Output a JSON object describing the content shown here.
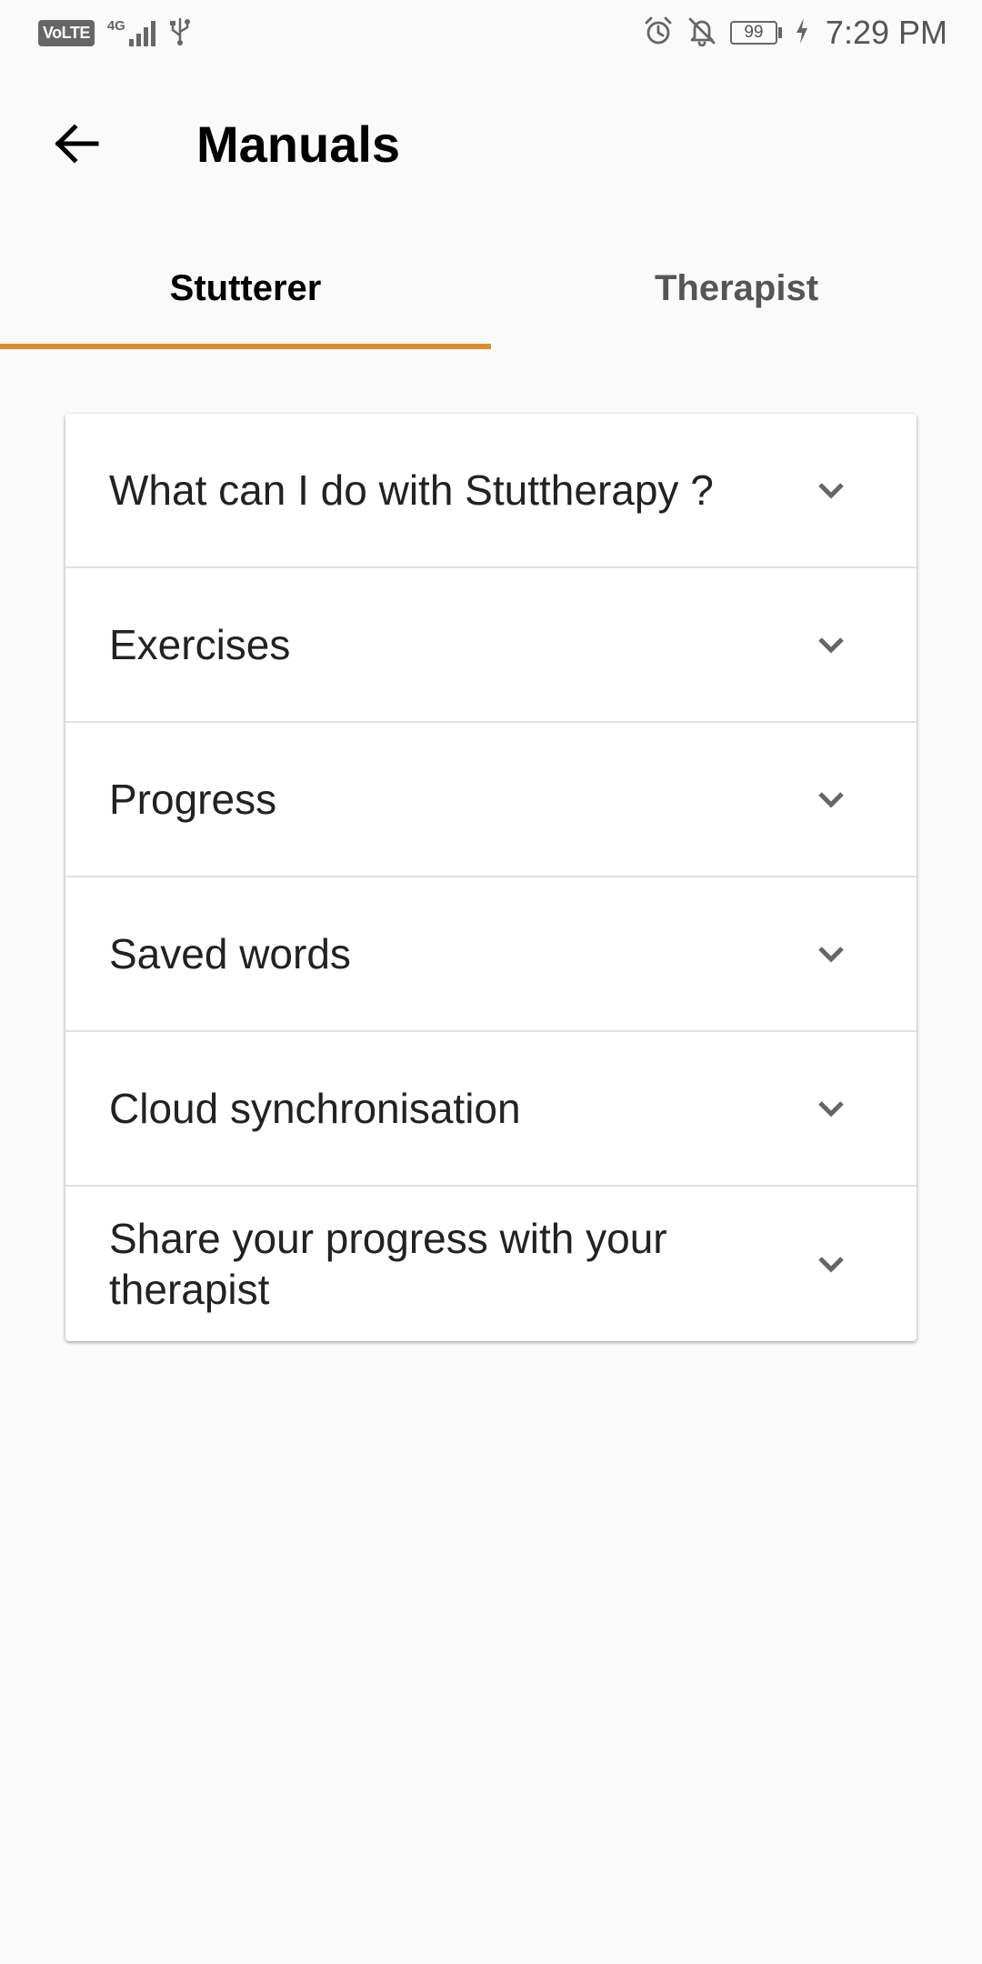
{
  "status_bar": {
    "volte": "VoLTE",
    "network": "4G",
    "battery": "99",
    "time": "7:29 PM"
  },
  "app_bar": {
    "title": "Manuals",
    "back_icon": "arrow-left-icon"
  },
  "tabs": [
    {
      "label": "Stutterer",
      "selected": true
    },
    {
      "label": "Therapist",
      "selected": false
    }
  ],
  "accent_color": "#e08a2e",
  "manual_sections": [
    {
      "label": "What can I do with Stuttherapy ?",
      "icon": "chevron-down-icon"
    },
    {
      "label": "Exercises",
      "icon": "chevron-down-icon"
    },
    {
      "label": "Progress",
      "icon": "chevron-down-icon"
    },
    {
      "label": "Saved words",
      "icon": "chevron-down-icon"
    },
    {
      "label": "Cloud synchronisation",
      "icon": "chevron-down-icon"
    },
    {
      "label": "Share your progress with your therapist",
      "icon": "chevron-down-icon"
    }
  ]
}
